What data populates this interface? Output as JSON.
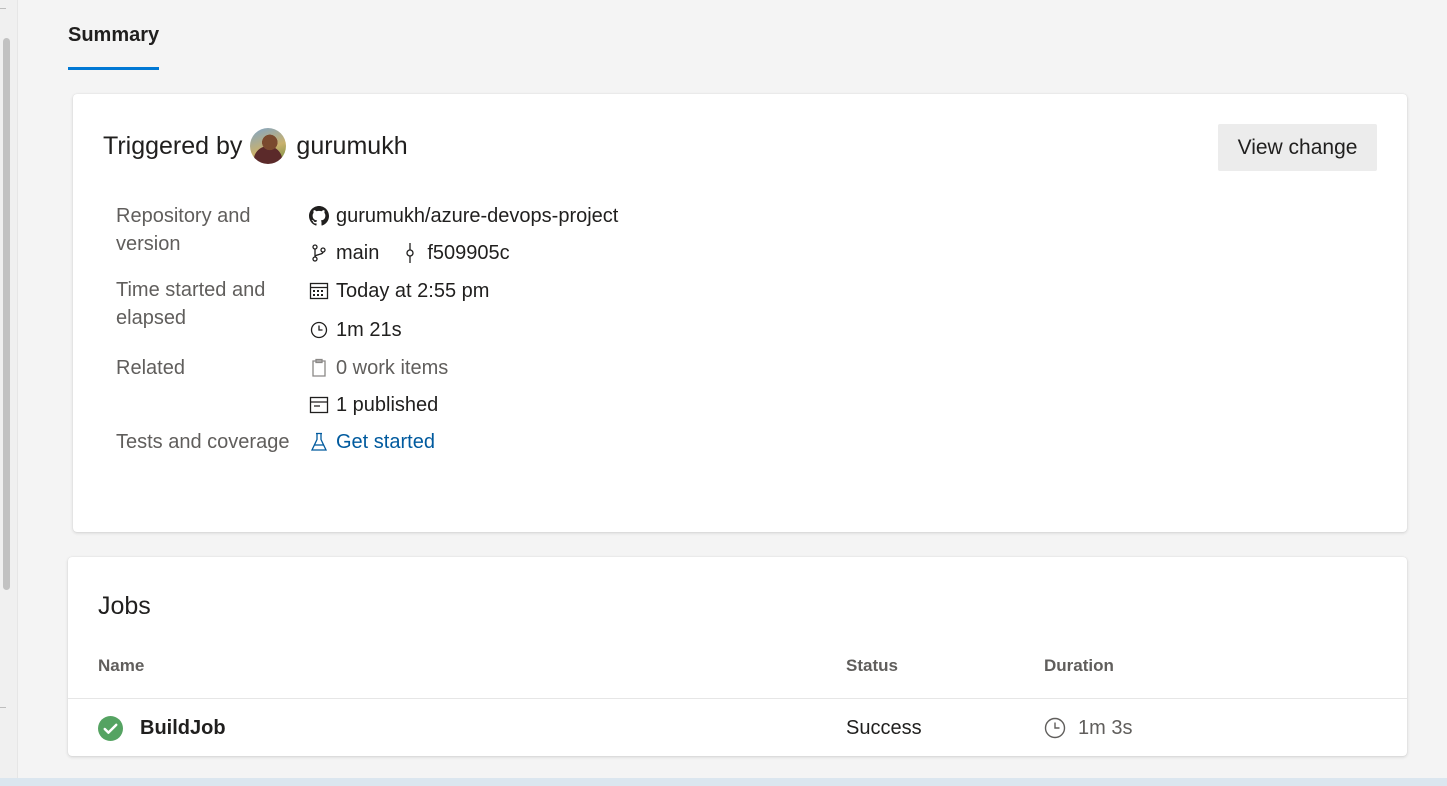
{
  "tabs": [
    {
      "label": "Summary",
      "active": true
    }
  ],
  "summary": {
    "triggered_prefix": "Triggered by",
    "user": "gurumukh",
    "view_change_label": "View change",
    "repository": {
      "label": "Repository and version",
      "repo": "gurumukh/azure-devops-project",
      "branch": "main",
      "commit": "f509905c"
    },
    "time": {
      "label": "Time started and elapsed",
      "started": "Today at 2:55 pm",
      "elapsed": "1m 21s"
    },
    "related": {
      "label": "Related",
      "work_items": "0 work items",
      "published": "1 published"
    },
    "tests": {
      "label": "Tests and coverage",
      "link": "Get started"
    }
  },
  "jobs": {
    "title": "Jobs",
    "columns": {
      "name": "Name",
      "status": "Status",
      "duration": "Duration"
    },
    "rows": [
      {
        "name": "BuildJob",
        "status": "Success",
        "duration": "1m 3s"
      }
    ]
  },
  "colors": {
    "accent": "#0078d4",
    "link": "#005a9e",
    "success": "#55a362"
  },
  "icons": [
    "github-icon",
    "branch-icon",
    "commit-icon",
    "calendar-icon",
    "clock-icon",
    "work-item-icon",
    "artifact-icon",
    "flask-icon",
    "success-check-icon"
  ]
}
